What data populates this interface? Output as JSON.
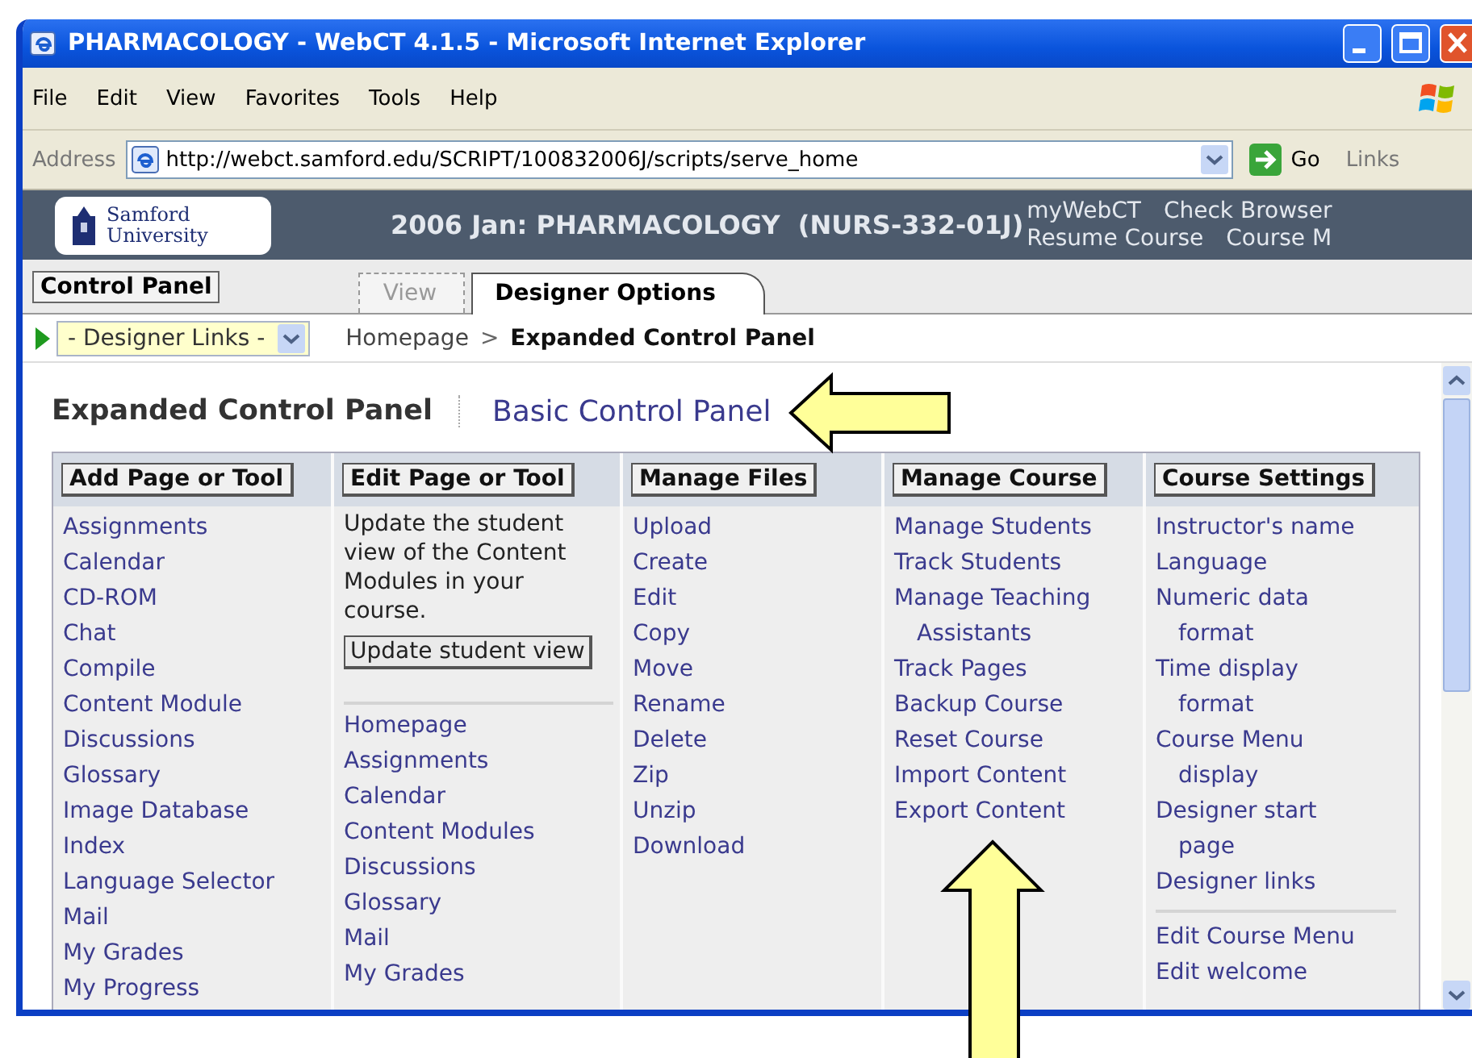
{
  "window": {
    "title": "PHARMACOLOGY - WebCT 4.1.5 - Microsoft Internet Explorer"
  },
  "menu": [
    "File",
    "Edit",
    "View",
    "Favorites",
    "Tools",
    "Help"
  ],
  "address_bar": {
    "label": "Address",
    "url": "http://webct.samford.edu/SCRIPT/100832006J/scripts/serve_home",
    "go": "Go",
    "links": "Links"
  },
  "header": {
    "logo": [
      "Samford",
      "University"
    ],
    "course_title": "2006 Jan: PHARMACOLOGY  (NURS-332-01J)",
    "links": [
      [
        "myWebCT",
        "Check Browser"
      ],
      [
        "Resume Course",
        "Course M"
      ]
    ]
  },
  "control_panel_button": "Control Panel",
  "tabs": [
    {
      "label": "View",
      "selected": false
    },
    {
      "label": "Designer Options",
      "selected": true
    }
  ],
  "designer_links": {
    "value": "- Designer Links -"
  },
  "breadcrumb": {
    "link": "Homepage",
    "separator": ">",
    "current": "Expanded Control Panel"
  },
  "panel": {
    "title": "Expanded Control Panel",
    "switch_link": "Basic Control Panel"
  },
  "columns": [
    {
      "heading": "Add Page or Tool",
      "groups": [
        [
          "Assignments",
          "Calendar",
          "CD-ROM",
          "Chat",
          "Compile",
          "Content Module",
          "Discussions",
          "Glossary",
          "Image Database",
          "Index",
          "Language Selector",
          "Mail",
          "My Grades",
          "My Progress"
        ]
      ]
    },
    {
      "heading": "Edit Page or Tool",
      "intro": "Update the student view of the Content Modules in your course.",
      "button": "Update student view",
      "groups": [
        [
          "Homepage",
          "Assignments",
          "Calendar",
          "Content Modules",
          "Discussions",
          "Glossary",
          "Mail",
          "My Grades"
        ]
      ]
    },
    {
      "heading": "Manage Files",
      "groups": [
        [
          "Upload",
          "Create",
          "Edit",
          "Copy",
          "Move",
          "Rename",
          "Delete",
          "Zip",
          "Unzip",
          "Download"
        ]
      ]
    },
    {
      "heading": "Manage Course",
      "groups": [
        [
          "Manage Students",
          "Track Students",
          "Manage Teaching Assistants",
          "Track Pages",
          "Backup Course",
          "Reset Course",
          "Import Content",
          "Export Content"
        ]
      ]
    },
    {
      "heading": "Course Settings",
      "groups": [
        [
          "Instructor's name",
          "Language",
          "Numeric data format",
          "Time display format",
          "Course Menu display",
          "Designer start page",
          "Designer links"
        ],
        [
          "Edit Course Menu",
          "Edit welcome"
        ]
      ]
    }
  ]
}
